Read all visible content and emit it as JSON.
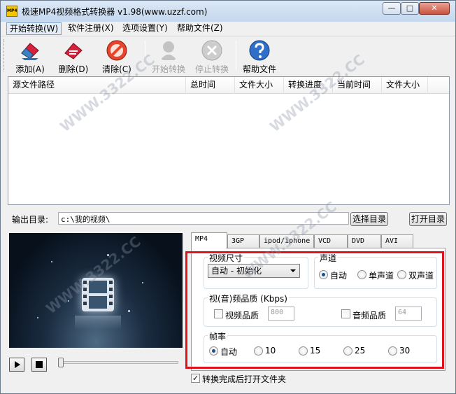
{
  "window": {
    "title": "极速MP4视频格式转换器 v1.98(www.uzzf.com)",
    "icon_text": "MP4",
    "controls": {
      "minimize": "—",
      "maximize": "□",
      "close": "✕"
    }
  },
  "menu": [
    "开始转换(W)",
    "软件注册(X)",
    "选项设置(Y)",
    "帮助文件(Z)"
  ],
  "toolbar": {
    "add": "添加(A)",
    "delete": "删除(D)",
    "clear": "清除(C)",
    "start": "开始转换",
    "stop": "停止转换",
    "help": "帮助文件"
  },
  "list": {
    "columns": [
      "源文件路径",
      "总时间",
      "文件大小",
      "转换进度",
      "当前时间",
      "文件大小"
    ]
  },
  "output": {
    "label": "输出目录:",
    "path": "c:\\我的视频\\",
    "select_button": "选择目录",
    "open_button": "打开目录"
  },
  "tabs": [
    "MP4",
    "3GP",
    "ipod/iphone",
    "VCD",
    "DVD",
    "AVI"
  ],
  "video_size": {
    "title": "视频尺寸",
    "selected": "自动 - 初始化"
  },
  "channel": {
    "title": "声道",
    "options": [
      "自动",
      "单声道",
      "双声道"
    ],
    "selected_index": 0
  },
  "quality": {
    "title": "视(音)频品质 (Kbps)",
    "video_label": "视频品质",
    "video_value": "800",
    "audio_label": "音频品质",
    "audio_value": "64"
  },
  "framerate": {
    "title": "帧率",
    "options": [
      "自动",
      "10",
      "15",
      "25",
      "30"
    ],
    "selected_index": 0
  },
  "open_after": {
    "label": "转换完成后打开文件夹",
    "checked": true
  },
  "watermark": "WWW.3322.CC",
  "colors": {
    "highlight": "#e0121b",
    "selected_radio": "#1c4f8a"
  }
}
